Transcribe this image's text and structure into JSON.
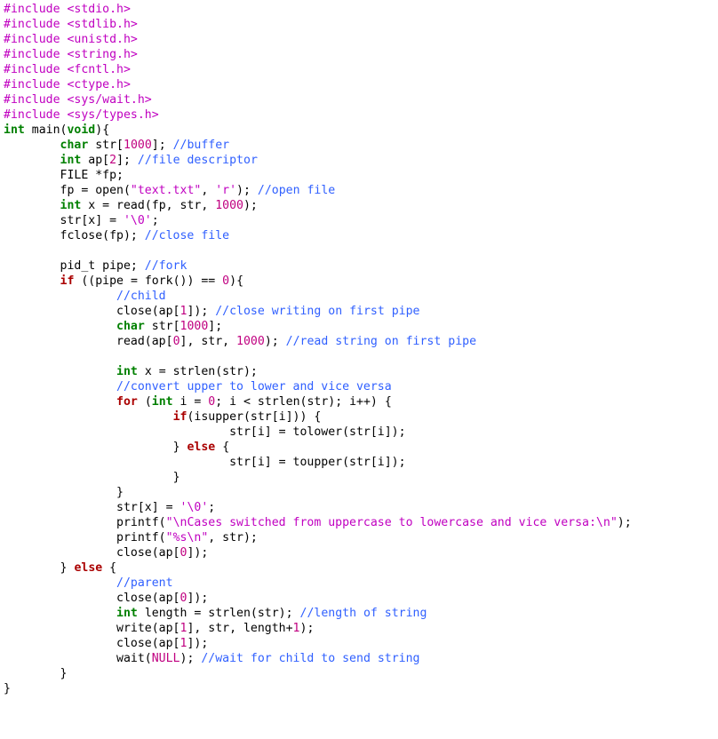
{
  "code": {
    "lines": [
      [
        [
          "pp",
          "#include "
        ],
        [
          "hdr",
          "<stdio.h>"
        ]
      ],
      [
        [
          "pp",
          "#include "
        ],
        [
          "hdr",
          "<stdlib.h>"
        ]
      ],
      [
        [
          "pp",
          "#include "
        ],
        [
          "hdr",
          "<unistd.h>"
        ]
      ],
      [
        [
          "pp",
          "#include "
        ],
        [
          "hdr",
          "<string.h>"
        ]
      ],
      [
        [
          "pp",
          "#include "
        ],
        [
          "hdr",
          "<fcntl.h>"
        ]
      ],
      [
        [
          "pp",
          "#include "
        ],
        [
          "hdr",
          "<ctype.h>"
        ]
      ],
      [
        [
          "pp",
          "#include "
        ],
        [
          "hdr",
          "<sys/wait.h>"
        ]
      ],
      [
        [
          "pp",
          "#include "
        ],
        [
          "hdr",
          "<sys/types.h>"
        ]
      ],
      [
        [
          "kw",
          "int"
        ],
        [
          "id",
          " main("
        ],
        [
          "kw",
          "void"
        ],
        [
          "id",
          ")"
        ],
        [
          "op",
          "{"
        ]
      ],
      [
        [
          "id",
          "        "
        ],
        [
          "kw",
          "char"
        ],
        [
          "id",
          " str["
        ],
        [
          "num",
          "1000"
        ],
        [
          "id",
          "]; "
        ],
        [
          "com",
          "//buffer"
        ]
      ],
      [
        [
          "id",
          "        "
        ],
        [
          "kw",
          "int"
        ],
        [
          "id",
          " ap["
        ],
        [
          "num",
          "2"
        ],
        [
          "id",
          "]; "
        ],
        [
          "com",
          "//file descriptor"
        ]
      ],
      [
        [
          "id",
          "        FILE *fp;"
        ]
      ],
      [
        [
          "id",
          "        fp = open("
        ],
        [
          "str",
          "\"text.txt\""
        ],
        [
          "id",
          ", "
        ],
        [
          "chr",
          "'r'"
        ],
        [
          "id",
          "); "
        ],
        [
          "com",
          "//open file"
        ]
      ],
      [
        [
          "id",
          "        "
        ],
        [
          "kw",
          "int"
        ],
        [
          "id",
          " x = read(fp, str, "
        ],
        [
          "num",
          "1000"
        ],
        [
          "id",
          ");"
        ]
      ],
      [
        [
          "id",
          "        str[x] = "
        ],
        [
          "chr",
          "'\\0'"
        ],
        [
          "id",
          ";"
        ]
      ],
      [
        [
          "id",
          "        fclose(fp); "
        ],
        [
          "com",
          "//close file"
        ]
      ],
      [
        [
          "id",
          ""
        ]
      ],
      [
        [
          "id",
          "        pid_t pipe; "
        ],
        [
          "com",
          "//fork"
        ]
      ],
      [
        [
          "id",
          "        "
        ],
        [
          "kwb",
          "if"
        ],
        [
          "id",
          " ((pipe = fork()) == "
        ],
        [
          "num",
          "0"
        ],
        [
          "id",
          ")"
        ],
        [
          "op",
          "{"
        ]
      ],
      [
        [
          "id",
          "                "
        ],
        [
          "com",
          "//child"
        ]
      ],
      [
        [
          "id",
          "                close(ap["
        ],
        [
          "num",
          "1"
        ],
        [
          "id",
          "]); "
        ],
        [
          "com",
          "//close writing on first pipe"
        ]
      ],
      [
        [
          "id",
          "                "
        ],
        [
          "kw",
          "char"
        ],
        [
          "id",
          " str["
        ],
        [
          "num",
          "1000"
        ],
        [
          "id",
          "];"
        ]
      ],
      [
        [
          "id",
          "                read(ap["
        ],
        [
          "num",
          "0"
        ],
        [
          "id",
          "], str, "
        ],
        [
          "num",
          "1000"
        ],
        [
          "id",
          "); "
        ],
        [
          "com",
          "//read string on first pipe"
        ]
      ],
      [
        [
          "id",
          ""
        ]
      ],
      [
        [
          "id",
          "                "
        ],
        [
          "kw",
          "int"
        ],
        [
          "id",
          " x = strlen(str);"
        ]
      ],
      [
        [
          "id",
          "                "
        ],
        [
          "com",
          "//convert upper to lower and vice versa"
        ]
      ],
      [
        [
          "id",
          "                "
        ],
        [
          "kwb",
          "for"
        ],
        [
          "id",
          " ("
        ],
        [
          "kw",
          "int"
        ],
        [
          "id",
          " i = "
        ],
        [
          "num",
          "0"
        ],
        [
          "id",
          "; i < strlen(str); i++) "
        ],
        [
          "op",
          "{"
        ]
      ],
      [
        [
          "id",
          "                        "
        ],
        [
          "kwb",
          "if"
        ],
        [
          "id",
          "(isupper(str[i])) "
        ],
        [
          "op",
          "{"
        ]
      ],
      [
        [
          "id",
          "                                str[i] = tolower(str[i]);"
        ]
      ],
      [
        [
          "id",
          "                        "
        ],
        [
          "op",
          "}"
        ],
        [
          "id",
          " "
        ],
        [
          "kwb",
          "else"
        ],
        [
          "id",
          " "
        ],
        [
          "op",
          "{"
        ]
      ],
      [
        [
          "id",
          "                                str[i] = toupper(str[i]);"
        ]
      ],
      [
        [
          "id",
          "                        "
        ],
        [
          "op",
          "}"
        ]
      ],
      [
        [
          "id",
          "                "
        ],
        [
          "op",
          "}"
        ]
      ],
      [
        [
          "id",
          "                str[x] = "
        ],
        [
          "chr",
          "'\\0'"
        ],
        [
          "id",
          ";"
        ]
      ],
      [
        [
          "id",
          "                printf("
        ],
        [
          "str",
          "\"\\nCases switched from uppercase to lowercase and vice versa:\\n\""
        ],
        [
          "id",
          ");"
        ]
      ],
      [
        [
          "id",
          "                printf("
        ],
        [
          "str",
          "\"%s\\n\""
        ],
        [
          "id",
          ", str);"
        ]
      ],
      [
        [
          "id",
          "                close(ap["
        ],
        [
          "num",
          "0"
        ],
        [
          "id",
          "]);"
        ]
      ],
      [
        [
          "id",
          "        "
        ],
        [
          "op",
          "}"
        ],
        [
          "id",
          " "
        ],
        [
          "kwb",
          "else"
        ],
        [
          "id",
          " "
        ],
        [
          "op",
          "{"
        ]
      ],
      [
        [
          "id",
          "                "
        ],
        [
          "com",
          "//parent"
        ]
      ],
      [
        [
          "id",
          "                close(ap["
        ],
        [
          "num",
          "0"
        ],
        [
          "id",
          "]);"
        ]
      ],
      [
        [
          "id",
          "                "
        ],
        [
          "kw",
          "int"
        ],
        [
          "id",
          " length = strlen(str); "
        ],
        [
          "com",
          "//length of string"
        ]
      ],
      [
        [
          "id",
          "                write(ap["
        ],
        [
          "num",
          "1"
        ],
        [
          "id",
          "], str, length+"
        ],
        [
          "num",
          "1"
        ],
        [
          "id",
          ");"
        ]
      ],
      [
        [
          "id",
          "                close(ap["
        ],
        [
          "num",
          "1"
        ],
        [
          "id",
          "]);"
        ]
      ],
      [
        [
          "id",
          "                wait("
        ],
        [
          "num",
          "NULL"
        ],
        [
          "id",
          "); "
        ],
        [
          "com",
          "//wait for child to send string"
        ]
      ],
      [
        [
          "id",
          "        "
        ],
        [
          "op",
          "}"
        ]
      ],
      [
        [
          "op",
          "}"
        ]
      ]
    ]
  }
}
